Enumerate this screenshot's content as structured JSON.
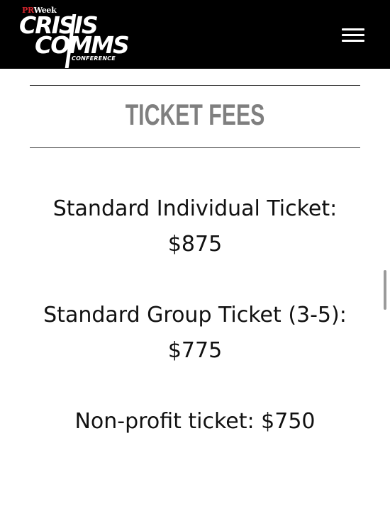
{
  "header": {
    "logo": {
      "publisher_prefix": "PR",
      "publisher_suffix": "Week",
      "line1": "CRISIS",
      "line2": "COMMS",
      "subtitle": "CONFERENCE"
    },
    "menu_icon": "hamburger-menu-icon"
  },
  "main": {
    "section_title": "TICKET FEES",
    "fees": [
      "Standard Individual Ticket: $875",
      "Standard Group Ticket (3-5): $775",
      "Non-profit ticket: $750"
    ]
  },
  "colors": {
    "header_bg": "#000000",
    "title_gray": "#7f7f7f",
    "prweek_red": "#d6262e"
  }
}
